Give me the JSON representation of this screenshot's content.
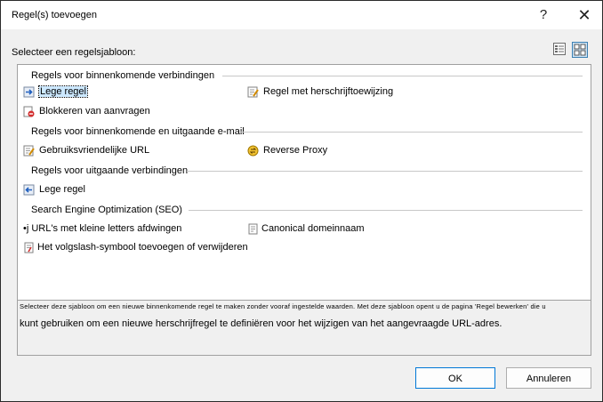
{
  "window": {
    "title": "Regel(s) toevoegen",
    "help_label": "?",
    "close_label": "✕"
  },
  "prompt": "Selecteer een regelsjabloon:",
  "view_buttons": {
    "list_icon": "details-view-icon",
    "tiles_icon": "tiles-view-icon"
  },
  "groups": [
    {
      "header": "Regels voor binnenkomende verbindingen",
      "items": [
        {
          "label": "Lege regel",
          "icon": "blank-rule-icon"
        },
        {
          "label": "Regel met herschrijftoewijzing",
          "icon": "rewrite-map-icon"
        },
        {
          "label": "Blokkeren van aanvragen",
          "icon": "block-requests-icon"
        }
      ]
    },
    {
      "header": "Regels voor binnenkomende en uitgaande e-mail",
      "items": [
        {
          "label": "Gebruiksvriendelijke URL",
          "icon": "friendly-url-icon"
        },
        {
          "label": "Reverse Proxy",
          "icon": "reverse-proxy-icon"
        }
      ]
    },
    {
      "header": "Regels voor uitgaande verbindingen",
      "items": [
        {
          "label": "Lege regel",
          "icon": "outbound-blank-rule-icon"
        }
      ]
    },
    {
      "header": "Search Engine Optimization (SEO)",
      "items": [
        {
          "label": "•j URL's met kleine letters afdwingen",
          "icon": "lowercase-url-icon"
        },
        {
          "label": "Canonical domeinnaam",
          "icon": "canonical-domain-icon"
        },
        {
          "label": "Het volgslash-symbool toevoegen of verwijderen",
          "icon": "trailing-slash-icon"
        }
      ]
    }
  ],
  "description": {
    "small": "Selecteer deze sjabloon om een nieuwe binnenkomende regel te maken zonder vooraf ingestelde waarden. Met deze sjabloon opent u de pagina 'Regel bewerken' die u",
    "main": "kunt gebruiken om een nieuwe herschrijfregel te definiëren voor het wijzigen van het aangevraagde URL-adres."
  },
  "buttons": {
    "ok": "OK",
    "cancel": "Annuleren"
  },
  "colors": {
    "accent": "#0078d7",
    "selection": "#cce8ff"
  }
}
